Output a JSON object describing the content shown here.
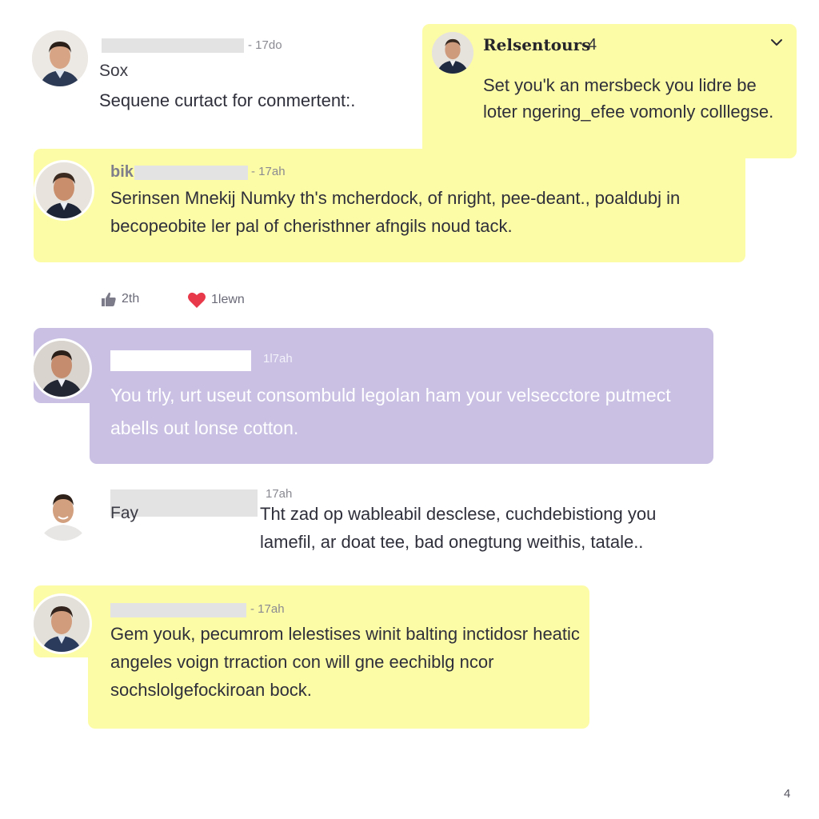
{
  "comments": [
    {
      "username": "Sox",
      "time": "- 17do",
      "text": "Sequene curtact for conmertent:."
    },
    {
      "thread_title": "Relsentours",
      "thread_count": "4",
      "text": "Set you'k an mersbeck you lidre be loter ngering_efee vomonly colllegse."
    },
    {
      "username": "bik",
      "time": "- 17ah",
      "text": "Serinsen Mnekij Numky th's mcherdock, of nright, pee-deant., poaldubj in becopeobite ler pal of cheristhner afngils noud tack."
    },
    {
      "time": "1l7ah",
      "text": "You trly, urt useut consombuld legolan ham your velsecctore putmect abells out lonse cotton."
    },
    {
      "username": "Fay",
      "time": "17ah",
      "text": "Tht zad op wableabil desclese, cuchdebistiong you lamefil, ar doat tee, bad onegtung weithis, tatale.."
    },
    {
      "time": "- 17ah",
      "text": "Gem youk, pecumrom lelestises winit balting inctidosr heatic angeles voign trraction con will gne eechiblg ncor sochslolgefockiroan bock."
    }
  ],
  "reactions": {
    "like_count": "2th",
    "love_count": "1lewn"
  },
  "page_number": "4",
  "colors": {
    "yellow_bubble": "#fdfca6",
    "purple_bubble": "#c9c0e3",
    "heart": "#e8394b"
  },
  "icons": {
    "like": "thumbs-up-icon",
    "love": "heart-icon",
    "collapse": "chevron-down-icon"
  }
}
